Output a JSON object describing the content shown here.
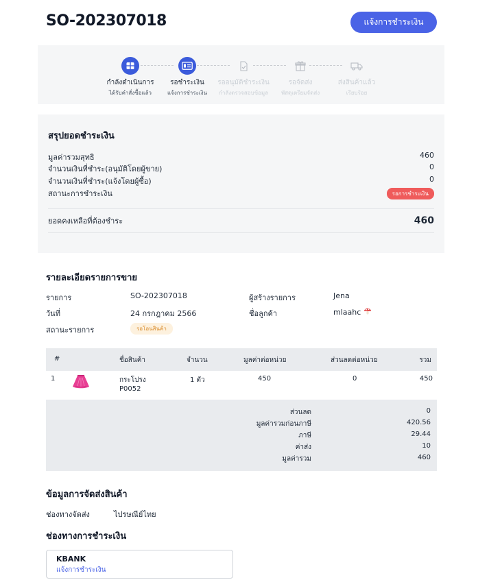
{
  "header": {
    "order_number": "SO-202307018",
    "pay_button_label": "แจ้งการชำระเงิน"
  },
  "steps": [
    {
      "title": "กำลังดำเนินการ",
      "subtitle": "ได้รับคำสั่งซื้อแล้ว",
      "state": "done",
      "icon": "box-icon"
    },
    {
      "title": "รอชำระเงิน",
      "subtitle": "แจ้งการชำระเงิน",
      "state": "current",
      "icon": "payment-card-icon"
    },
    {
      "title": "รออนุมัติชำระเงิน",
      "subtitle": "กำลังตรวจสอบข้อมูล",
      "state": "pending",
      "icon": "document-check-icon"
    },
    {
      "title": "รอจัดส่ง",
      "subtitle": "พัสดุเตรียมจัดส่ง",
      "state": "pending",
      "icon": "package-icon"
    },
    {
      "title": "ส่งสินค้าแล้ว",
      "subtitle": "เรียบร้อย",
      "state": "pending",
      "icon": "truck-icon"
    }
  ],
  "summary": {
    "title": "สรุปยอดชำระเงิน",
    "rows": [
      {
        "label": "มูลค่ารวมสุทธิ",
        "value": "460"
      },
      {
        "label": "จำนวนเงินที่ชำระ(อนุมัติโดยผู้ขาย)",
        "value": "0"
      },
      {
        "label": "จำนวนเงินที่ชำระ(แจ้งโดยผู้ซื้อ)",
        "value": "0"
      }
    ],
    "status_label": "สถานะการชำระเงิน",
    "status_badge": "รอการชำระเงิน",
    "balance_label": "ยอดคงเหลือที่ต้องชำระ",
    "balance_value": "460"
  },
  "details": {
    "title": "รายละเอียดรายการขาย",
    "item_label": "รายการ",
    "item_value": "SO-202307018",
    "date_label": "วันที่",
    "date_value": "24 กรกฎาคม 2566",
    "status_label": "สถานะรายการ",
    "status_badge": "รอโอนสินค้า",
    "creator_label": "ผู้สร้างรายการ",
    "creator_value": "Jena",
    "customer_label": "ชื่อลูกค้า",
    "customer_value": "mlaahc"
  },
  "table": {
    "headers": [
      "#",
      "ชื่อสินค้า",
      "จำนวน",
      "มูลค่าต่อหน่วย",
      "ส่วนลดต่อหน่วย",
      "รวม"
    ],
    "rows": [
      {
        "index": "1",
        "name_line1": "กระโปรง",
        "name_line2": "P0052",
        "qty": "1 ตัว",
        "unit_price": "450",
        "discount": "0",
        "total": "450"
      }
    ],
    "footer": [
      {
        "label": "ส่วนลด",
        "value": "0"
      },
      {
        "label": "มูลค่ารวมก่อนภาษี",
        "value": "420.56"
      },
      {
        "label": "ภาษี",
        "value": "29.44"
      },
      {
        "label": "ค่าส่ง",
        "value": "10"
      },
      {
        "label": "มูลค่ารวม",
        "value": "460"
      }
    ]
  },
  "shipping": {
    "title": "ข้อมูลการจัดส่งสินค้า",
    "channel_label": "ช่องทางจัดส่ง",
    "channel_value": "ไปรษณีย์ไทย"
  },
  "payment": {
    "title": "ช่องทางการชำระเงิน",
    "bank": "KBANK",
    "action": "แจ้งการชำระเงิน"
  },
  "colors": {
    "primary": "#4a63e6",
    "danger_badge": "#ef5b5b",
    "warning_badge_bg": "#fdf1de",
    "panel_bg": "#f5f6f7"
  }
}
